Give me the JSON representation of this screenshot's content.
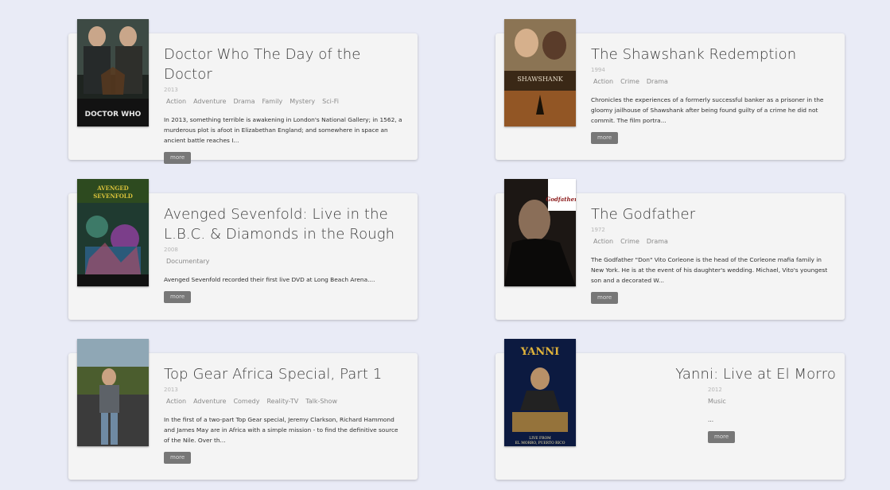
{
  "movies": [
    {
      "title": "Doctor Who The Day of the Doctor",
      "year": "2013",
      "genres": [
        "Action",
        "Adventure",
        "Drama",
        "Family",
        "Mystery",
        "Sci-Fi"
      ],
      "description": "In 2013, something terrible is awakening in London's National Gallery; in 1562, a murderous plot is afoot in Elizabethan England; and somewhere in space an ancient battle reaches I...",
      "more_label": "more",
      "poster_text": "DOCTOR WHO"
    },
    {
      "title": "The Shawshank Redemption",
      "year": "1994",
      "genres": [
        "Action",
        "Crime",
        "Drama"
      ],
      "description": "Chronicles the experiences of a formerly successful banker as a prisoner in the gloomy jailhouse of Shawshank after being found guilty of a crime he did not commit. The film portra...",
      "more_label": "more",
      "poster_text": "SHAWSHANK"
    },
    {
      "title": "Avenged Sevenfold: Live in the L.B.C. & Diamonds in the Rough",
      "year": "2008",
      "genres": [
        "Documentary"
      ],
      "description": "Avenged Sevenfold recorded their first live DVD at Long Beach Arena....",
      "more_label": "more",
      "poster_text": "AVENGED SEVENFOLD"
    },
    {
      "title": "The Godfather",
      "year": "1972",
      "genres": [
        "Action",
        "Crime",
        "Drama"
      ],
      "description": "The Godfather \"Don\" Vito Corleone is the head of the Corleone mafia family in New York. He is at the event of his daughter's wedding. Michael, Vito's youngest son and a decorated W...",
      "more_label": "more",
      "poster_text": "Godfather"
    },
    {
      "title": "Top Gear Africa Special, Part 1",
      "year": "2013",
      "genres": [
        "Action",
        "Adventure",
        "Comedy",
        "Reality-TV",
        "Talk-Show"
      ],
      "description": "In the first of a two-part Top Gear special, Jeremy Clarkson, Richard Hammond and James May are in Africa with a simple mission - to find the definitive source of the Nile. Over th...",
      "more_label": "more",
      "poster_text": ""
    },
    {
      "title": "Yanni: Live at El Morro",
      "year": "2012",
      "genres": [
        "Music"
      ],
      "description": "...",
      "more_label": "more",
      "poster_text": "YANNI",
      "poster_subtext": "LIVE FROM EL MORRO, PUERTO RICO"
    }
  ]
}
